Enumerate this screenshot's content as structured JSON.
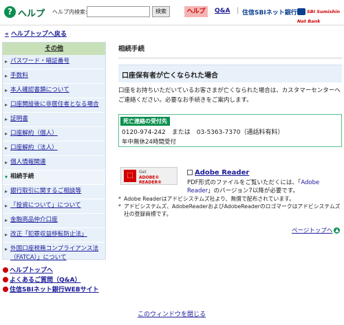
{
  "header": {
    "icon_glyph": "?",
    "title": "ヘルプ",
    "search_label": "ヘルプ内検索:",
    "search_value": "",
    "search_button": "検索",
    "tab_help": "ヘルプ",
    "tab_qa": "Q&A",
    "separator": "|",
    "brand": "住信SBIネット銀行",
    "logo_text": "SBI Sumishin Net Bank"
  },
  "back_link": {
    "arrow": "«",
    "label": "ヘルプトップへ戻る"
  },
  "sidebar": {
    "heading": "その他",
    "items": [
      {
        "label": "パスワード・暗証番号"
      },
      {
        "label": "手数料"
      },
      {
        "label": "本人確認書類について"
      },
      {
        "label": "口座開設後に非居住者となる場合"
      },
      {
        "label": "証明書"
      },
      {
        "label": "口座解約（個人）"
      },
      {
        "label": "口座解約（法人）"
      },
      {
        "label": "個人情報関連"
      },
      {
        "label": "相続手続"
      },
      {
        "label": "銀行取引に関するご相談等"
      },
      {
        "label": "「投資について」について"
      },
      {
        "label": "金融商品仲介口座"
      },
      {
        "label": "改正「犯罪収益移転防止法」"
      },
      {
        "label": "外国口座税務コンプライアンス法（FATCA）」について"
      }
    ],
    "active_index": 8
  },
  "bottom_links": [
    {
      "label": "ヘルプトップへ"
    },
    {
      "label": "よくあるご質問（Q&A）"
    },
    {
      "label": "住信SBIネット銀行WEBサイト"
    }
  ],
  "close_link": "このウィンドウを閉じる",
  "main": {
    "title": "相続手続",
    "section_title": "口座保有者が亡くなられた場合",
    "body": "口座をお持ちいただいているお客さまが亡くなられた場合は、カスタマーセンターへご連絡ください。必要なお手続きをご案内します。",
    "contact": {
      "title": "死亡連絡の受付先",
      "phone_line": "0120-974-242　または　03-5363-7370（通話料有料）",
      "hours": "年中無休24時間受付"
    },
    "adobe": {
      "button_get": "Get",
      "button_reader": "ADOBE® READER®",
      "link": "Adobe Reader",
      "desc_before": "PDF形式のファイルをご覧いただくには、「",
      "desc_link": "Adobe Reader",
      "desc_after": "」のバージョン7以降が必要です。"
    },
    "notes": [
      {
        "mark": "*",
        "text": "Adobe Readerはアドビシステムズ社より、無償で配布されています。"
      },
      {
        "mark": "*",
        "text": "アドビシステムズ、AdobeReaderおよびAdobeReaderのロゴマークはアドビシステムズ社の登録商標です。"
      }
    ],
    "pagetop": "ページトップへ",
    "pagetop_glyph": "▲"
  }
}
